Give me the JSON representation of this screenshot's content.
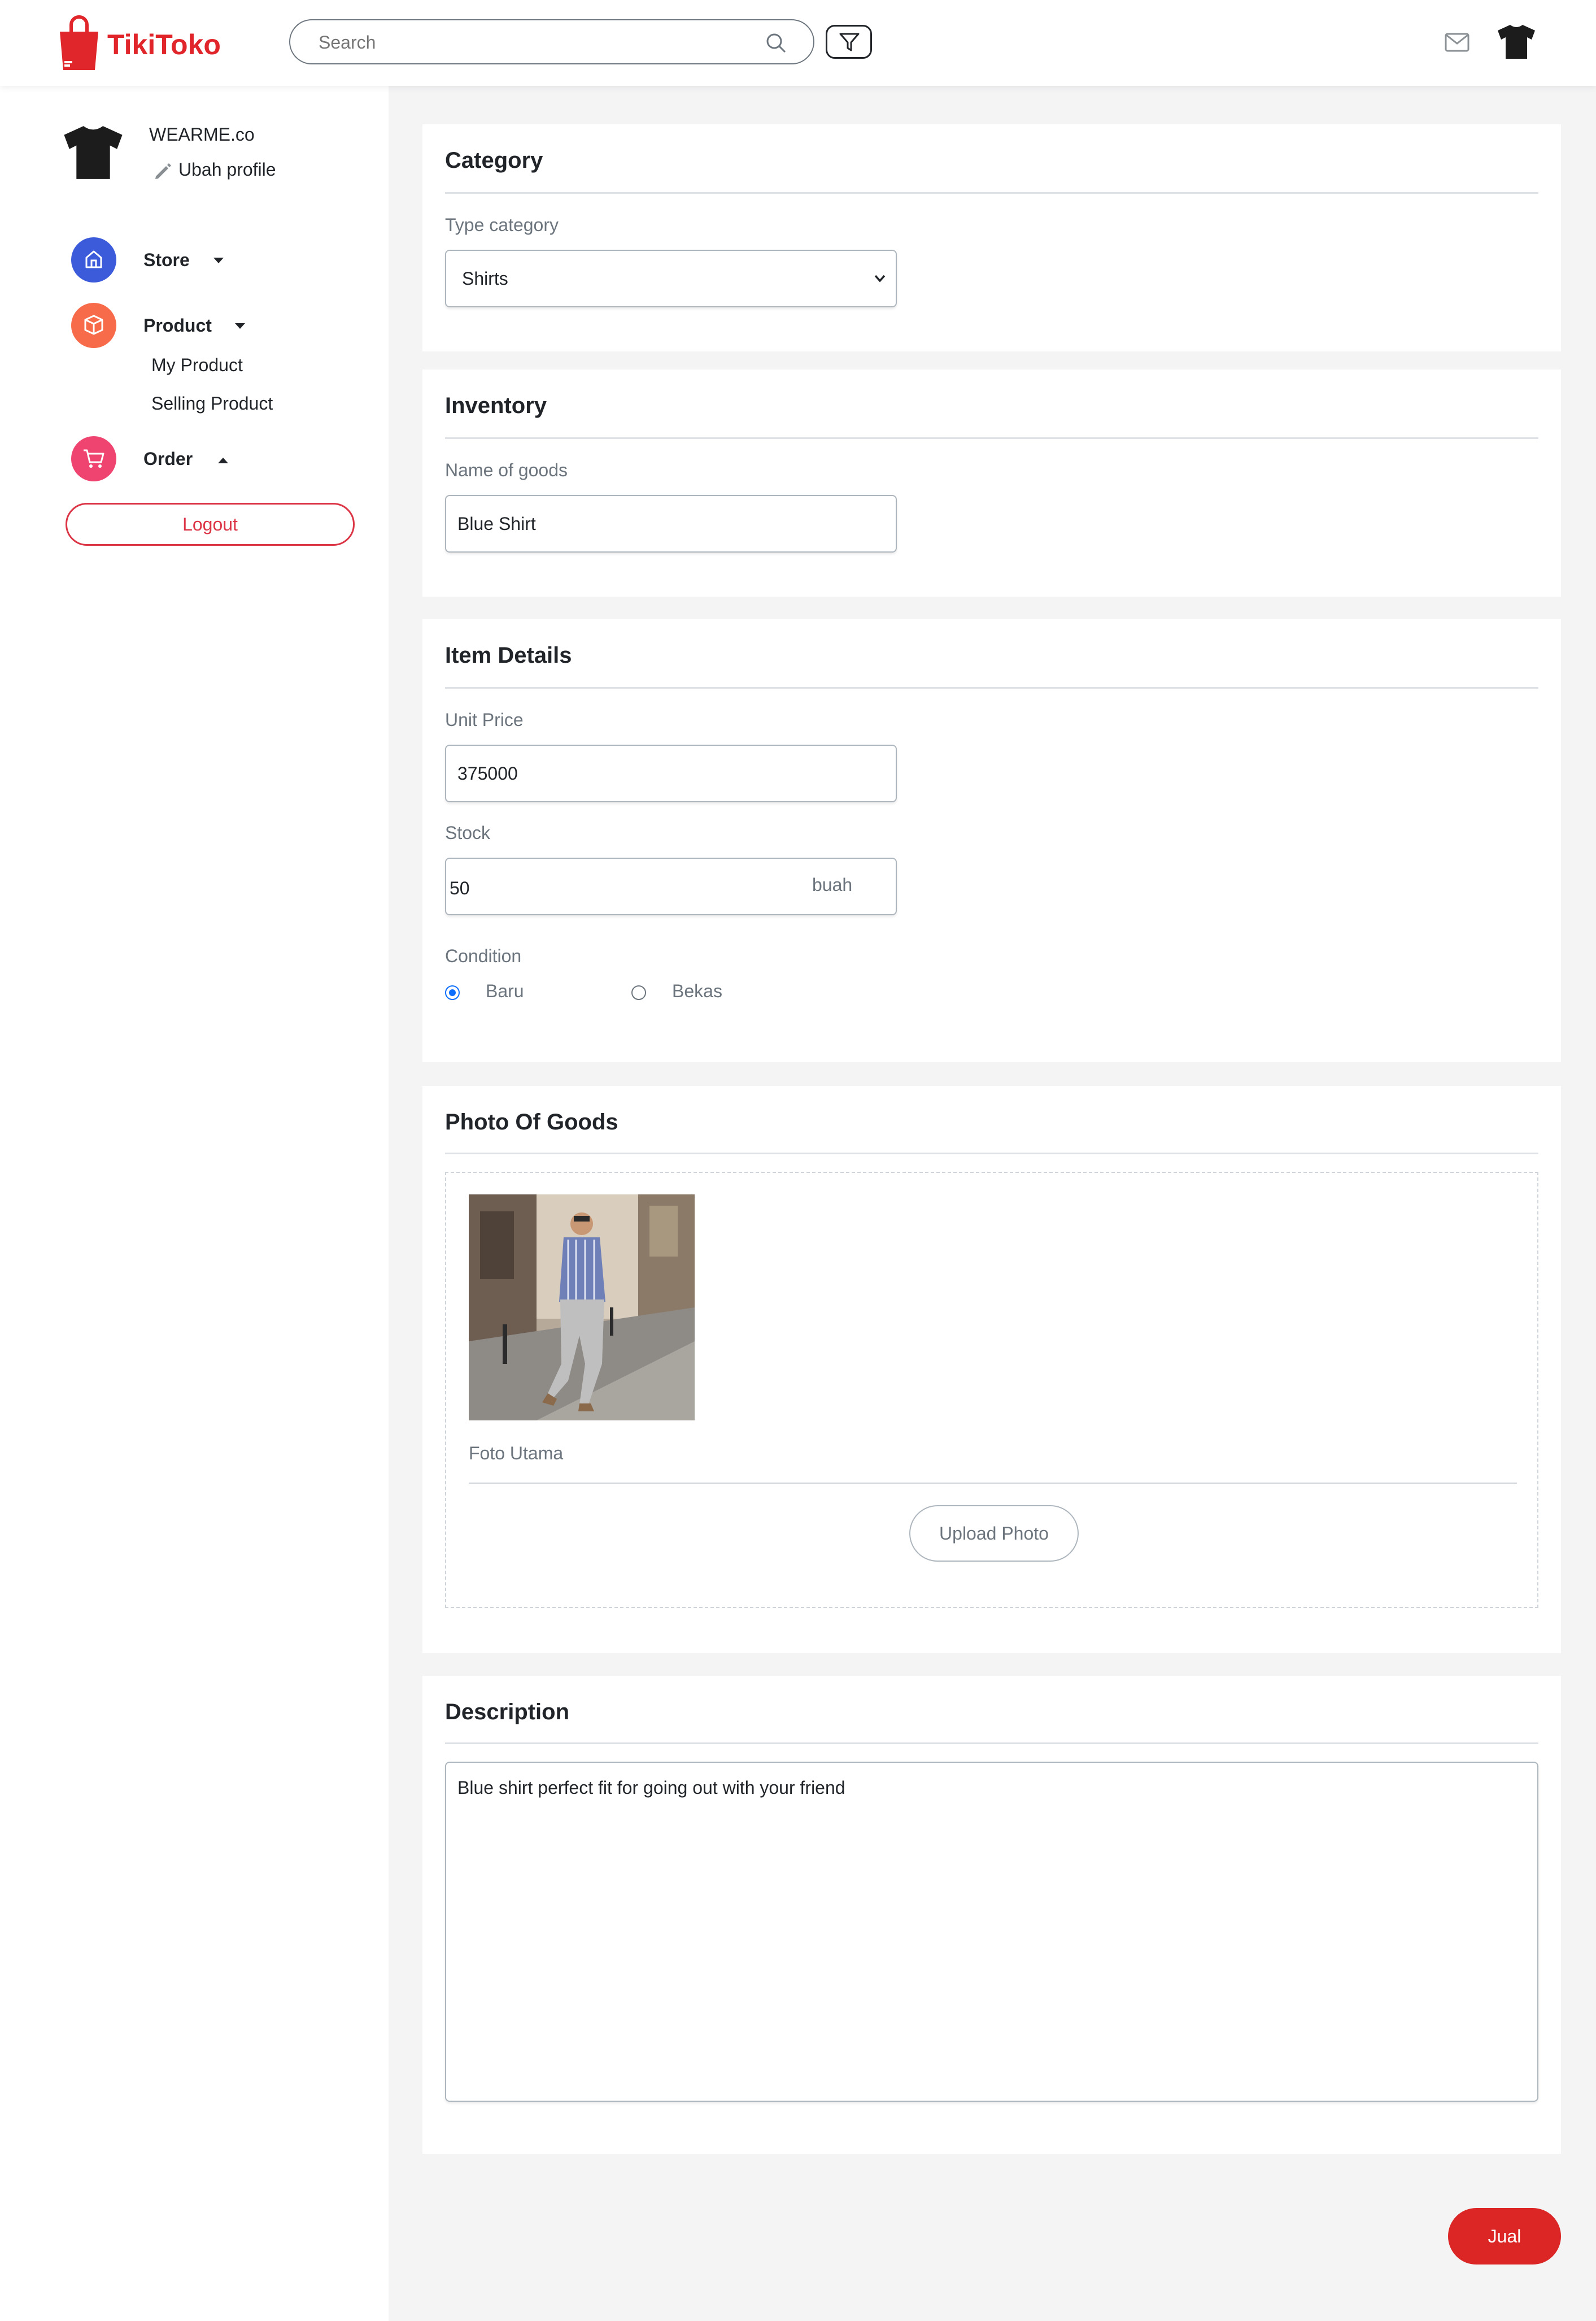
{
  "brand": {
    "name": "TikiToko"
  },
  "header": {
    "search_placeholder": "Search"
  },
  "profile": {
    "store_name": "WEARME.co",
    "edit_label": "Ubah profile"
  },
  "sidebar": {
    "store_label": "Store",
    "product_label": "Product",
    "product_items": [
      "My Product",
      "Selling Product"
    ],
    "order_label": "Order",
    "logout_label": "Logout"
  },
  "category": {
    "title": "Category",
    "type_label": "Type category",
    "selected": "Shirts"
  },
  "inventory": {
    "title": "Inventory",
    "name_label": "Name of goods",
    "name_value": "Blue Shirt"
  },
  "details": {
    "title": "Item Details",
    "price_label": "Unit Price",
    "price_value": "375000",
    "stock_label": "Stock",
    "stock_value": "50",
    "stock_unit": "buah",
    "condition_label": "Condition",
    "condition_options": [
      "Baru",
      "Bekas"
    ],
    "condition_selected": "Baru"
  },
  "photo": {
    "title": "Photo Of Goods",
    "main_caption": "Foto Utama",
    "upload_label": "Upload Photo"
  },
  "description": {
    "title": "Description",
    "text": "Blue shirt perfect fit for going out with your friend"
  },
  "actions": {
    "submit_label": "Jual"
  },
  "colors": {
    "brand_red": "#e0262b",
    "store_icon_bg": "#3b5bdb",
    "product_icon_bg": "#f76b4a",
    "order_icon_bg": "#ef4470",
    "radio_selected": "#0d6efd",
    "submit_bg": "#dc2626"
  },
  "icons": [
    "shopping-bag-icon",
    "search-icon",
    "filter-icon",
    "mail-icon",
    "tshirt-icon",
    "pencil-icon",
    "home-icon",
    "box-icon",
    "cart-icon",
    "caret-down-icon",
    "caret-up-icon",
    "chevron-down-icon"
  ]
}
